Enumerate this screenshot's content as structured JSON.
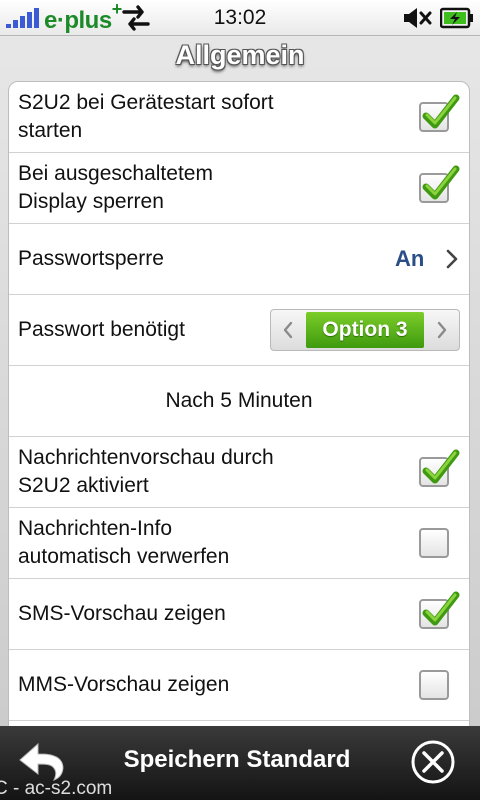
{
  "status_bar": {
    "carrier": "e·plus",
    "carrier_plus": "+",
    "time": "13:02",
    "icons": [
      "signal-icon",
      "data-transfer-icon",
      "mute-icon",
      "battery-charging-icon"
    ]
  },
  "header": {
    "title": "Allgemein"
  },
  "settings": {
    "row1": {
      "label_line1": "S2U2 bei Gerätestart sofort",
      "label_line2": "starten",
      "checked": true
    },
    "row2": {
      "label_line1": "Bei ausgeschaltetem",
      "label_line2": "Display sperren",
      "checked": true
    },
    "row3": {
      "label": "Passwortsperre",
      "value": "An"
    },
    "row4": {
      "label": "Passwort benötigt",
      "option": "Option 3"
    },
    "row5": {
      "text": "Nach 5 Minuten"
    },
    "row6": {
      "label_line1": "Nachrichtenvorschau durch",
      "label_line2": "S2U2 aktiviert",
      "checked": true
    },
    "row7": {
      "label_line1": "Nachrichten-Info",
      "label_line2": "automatisch verwerfen",
      "checked": false
    },
    "row8": {
      "label": "SMS-Vorschau zeigen",
      "checked": true
    },
    "row9": {
      "label": "MMS-Vorschau zeigen",
      "checked": false
    }
  },
  "bottom_bar": {
    "label": "Speichern Standard",
    "icons": [
      "back-arrow-icon",
      "close-icon"
    ]
  },
  "watermark": "C - ac-s2.com",
  "colors": {
    "accent_green": "#4fa816",
    "value_blue": "#2a4e86",
    "bottom_bar": "#1e1e1e"
  }
}
